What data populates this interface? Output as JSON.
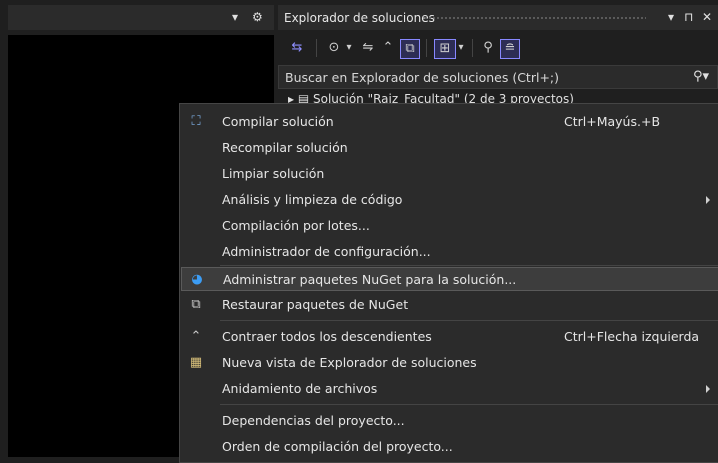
{
  "left_panel": {
    "dropdown_glyph": "▾",
    "settings_glyph": "⚙"
  },
  "solution_explorer": {
    "title": "Explorador de soluciones",
    "title_controls": [
      "▾",
      "⊓",
      "✕"
    ],
    "toolbar": [
      "⇆",
      "⊙",
      "▾",
      "⇋",
      "⌃",
      "⧉",
      "⊞",
      "▾",
      "⚲",
      "≘"
    ],
    "search_placeholder": "Buscar en Explorador de soluciones (Ctrl+;)",
    "search_icon": "⚲▾",
    "tree_first_row": "▸ ▤ Solución \"Raiz_Facultad\" (2 de 3 proyectos)"
  },
  "context_menu": {
    "items": [
      {
        "icon": "build-icon",
        "glyph": "⛶",
        "label": "Compilar solución",
        "shortcut": "Ctrl+Mayús.+B"
      },
      {
        "icon": "",
        "glyph": "",
        "label": "Recompilar solución",
        "shortcut": ""
      },
      {
        "icon": "",
        "glyph": "",
        "label": "Limpiar solución",
        "shortcut": ""
      },
      {
        "icon": "",
        "glyph": "",
        "label": "Análisis y limpieza de código",
        "shortcut": "",
        "submenu": true
      },
      {
        "icon": "",
        "glyph": "",
        "label": "Compilación por lotes...",
        "shortcut": ""
      },
      {
        "icon": "",
        "glyph": "",
        "label": "Administrador de configuración...",
        "shortcut": ""
      },
      {
        "icon": "nuget-icon",
        "glyph": "◕",
        "label": "Administrar paquetes NuGet para la solución...",
        "shortcut": "",
        "highlighted": true
      },
      {
        "icon": "restore-packages-icon",
        "glyph": "⧉",
        "label": "Restaurar paquetes de NuGet",
        "shortcut": ""
      },
      {
        "icon": "collapse-icon",
        "glyph": "⌃",
        "label": "Contraer todos los descendientes",
        "shortcut": "Ctrl+Flecha izquierda"
      },
      {
        "icon": "new-view-icon",
        "glyph": "▦",
        "label": "Nueva vista de Explorador de soluciones",
        "shortcut": ""
      },
      {
        "icon": "",
        "glyph": "",
        "label": "Anidamiento de archivos",
        "shortcut": "",
        "submenu": true
      },
      {
        "icon": "",
        "glyph": "",
        "label": "Dependencias del proyecto...",
        "shortcut": ""
      },
      {
        "icon": "",
        "glyph": "",
        "label": "Orden de compilación del proyecto...",
        "shortcut": ""
      }
    ]
  },
  "colors": {
    "background": "#1f1f1f",
    "menu_bg": "#2b2b2b",
    "highlight": "#3d3d3d",
    "accent": "#8888ff",
    "nuget_blue": "#3c9df5"
  }
}
